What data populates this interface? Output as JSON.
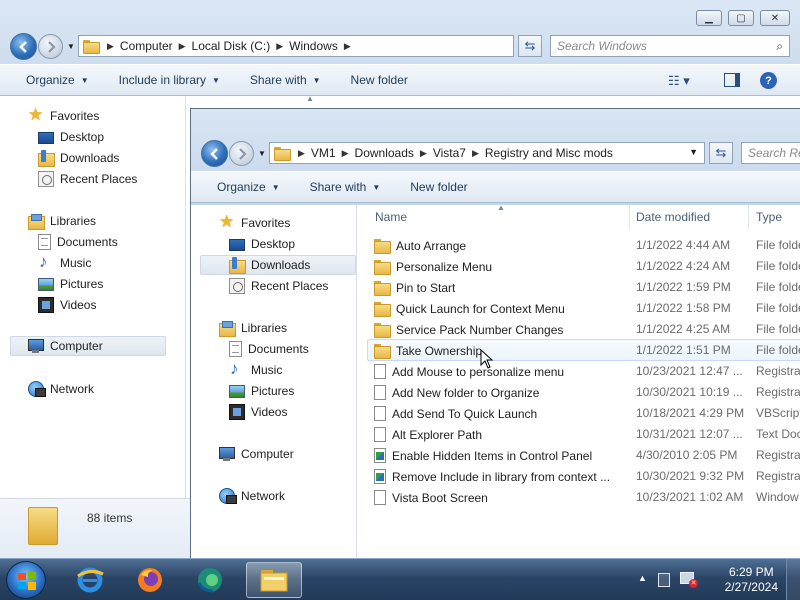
{
  "back_window": {
    "address": [
      "Computer",
      "Local Disk (C:)",
      "Windows"
    ],
    "search_placeholder": "Search Windows",
    "toolbar": {
      "organize": "Organize",
      "include_in_library": "Include in library",
      "share_with": "Share with",
      "new_folder": "New folder"
    },
    "nav": {
      "favorites": "Favorites",
      "desktop": "Desktop",
      "downloads": "Downloads",
      "recent_places": "Recent Places",
      "libraries": "Libraries",
      "documents": "Documents",
      "music": "Music",
      "pictures": "Pictures",
      "videos": "Videos",
      "computer": "Computer",
      "network": "Network"
    },
    "status": "88 items"
  },
  "front_window": {
    "address": [
      "VM1",
      "Downloads",
      "Vista7",
      "Registry and Misc mods"
    ],
    "search_placeholder": "Search Re",
    "toolbar": {
      "organize": "Organize",
      "share_with": "Share with",
      "new_folder": "New folder"
    },
    "nav": {
      "favorites": "Favorites",
      "desktop": "Desktop",
      "downloads": "Downloads",
      "recent_places": "Recent Places",
      "libraries": "Libraries",
      "documents": "Documents",
      "music": "Music",
      "pictures": "Pictures",
      "videos": "Videos",
      "computer": "Computer",
      "network": "Network"
    },
    "columns": {
      "name": "Name",
      "date": "Date modified",
      "type": "Type"
    },
    "files": [
      {
        "name": "Auto Arrange",
        "date": "1/1/2022 4:44 AM",
        "type": "File folde",
        "icon": "folder-icon"
      },
      {
        "name": "Personalize Menu",
        "date": "1/1/2022 4:24 AM",
        "type": "File folde",
        "icon": "folder-icon"
      },
      {
        "name": "Pin to Start",
        "date": "1/1/2022 1:59 PM",
        "type": "File folde",
        "icon": "folder-icon"
      },
      {
        "name": "Quick Launch for Context Menu",
        "date": "1/1/2022 1:58 PM",
        "type": "File folde",
        "icon": "folder-icon"
      },
      {
        "name": "Service Pack Number Changes",
        "date": "1/1/2022 4:25 AM",
        "type": "File folde",
        "icon": "folder-icon"
      },
      {
        "name": "Take Ownership",
        "date": "1/1/2022 1:51 PM",
        "type": "File folde",
        "icon": "folder-icon"
      },
      {
        "name": "Add Mouse to personalize menu",
        "date": "10/23/2021 12:47 ...",
        "type": "Registrat",
        "icon": "file-icon"
      },
      {
        "name": "Add New folder to Organize",
        "date": "10/30/2021 10:19 ...",
        "type": "Registrat",
        "icon": "file-icon"
      },
      {
        "name": "Add Send To Quick Launch",
        "date": "10/18/2021 4:29 PM",
        "type": "VBScript",
        "icon": "file-icon"
      },
      {
        "name": "Alt Explorer Path",
        "date": "10/31/2021 12:07 ...",
        "type": "Text Doc",
        "icon": "file-icon"
      },
      {
        "name": "Enable Hidden Items in Control Panel",
        "date": "4/30/2010 2:05 PM",
        "type": "Registrat",
        "icon": "registry-icon"
      },
      {
        "name": "Remove Include in library from context ...",
        "date": "10/30/2021 9:32 PM",
        "type": "Registrat",
        "icon": "registry-icon"
      },
      {
        "name": "Vista Boot Screen",
        "date": "10/23/2021 1:02 AM",
        "type": "Window",
        "icon": "file-icon"
      }
    ]
  },
  "taskbar": {
    "time": "6:29 PM",
    "date": "2/27/2024"
  }
}
